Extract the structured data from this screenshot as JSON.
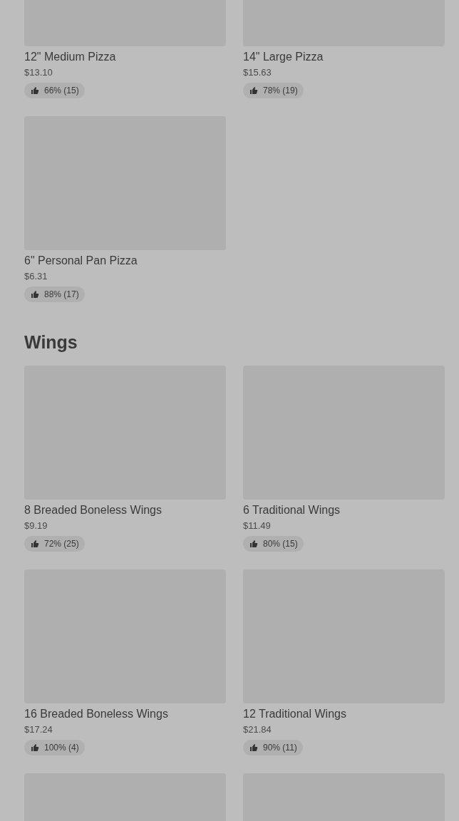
{
  "sections": [
    {
      "items": [
        {
          "kind": "top-cut",
          "name": "12\" Medium Pizza",
          "price": "$13.10",
          "rating": "66% (15)"
        },
        {
          "kind": "top-cut",
          "name": "14\" Large Pizza",
          "price": "$15.63",
          "rating": "78% (19)"
        },
        {
          "kind": "dish",
          "name": "6\" Personal Pan Pizza",
          "price": "$6.31",
          "rating": "88% (17)"
        }
      ]
    },
    {
      "title": "Wings",
      "items": [
        {
          "kind": "dish",
          "name": "8 Breaded Boneless Wings",
          "price": "$9.19",
          "rating": "72% (25)"
        },
        {
          "kind": "dish",
          "name": "6 Traditional Wings",
          "price": "$11.49",
          "rating": "80% (15)"
        },
        {
          "kind": "dish",
          "name": "16 Breaded Boneless Wings",
          "price": "$17.24",
          "rating": "100% (4)"
        },
        {
          "kind": "dish",
          "name": "12 Traditional Wings",
          "price": "$21.84",
          "rating": "90% (11)"
        },
        {
          "kind": "bottom-cut"
        },
        {
          "kind": "bottom-cut"
        }
      ]
    }
  ]
}
